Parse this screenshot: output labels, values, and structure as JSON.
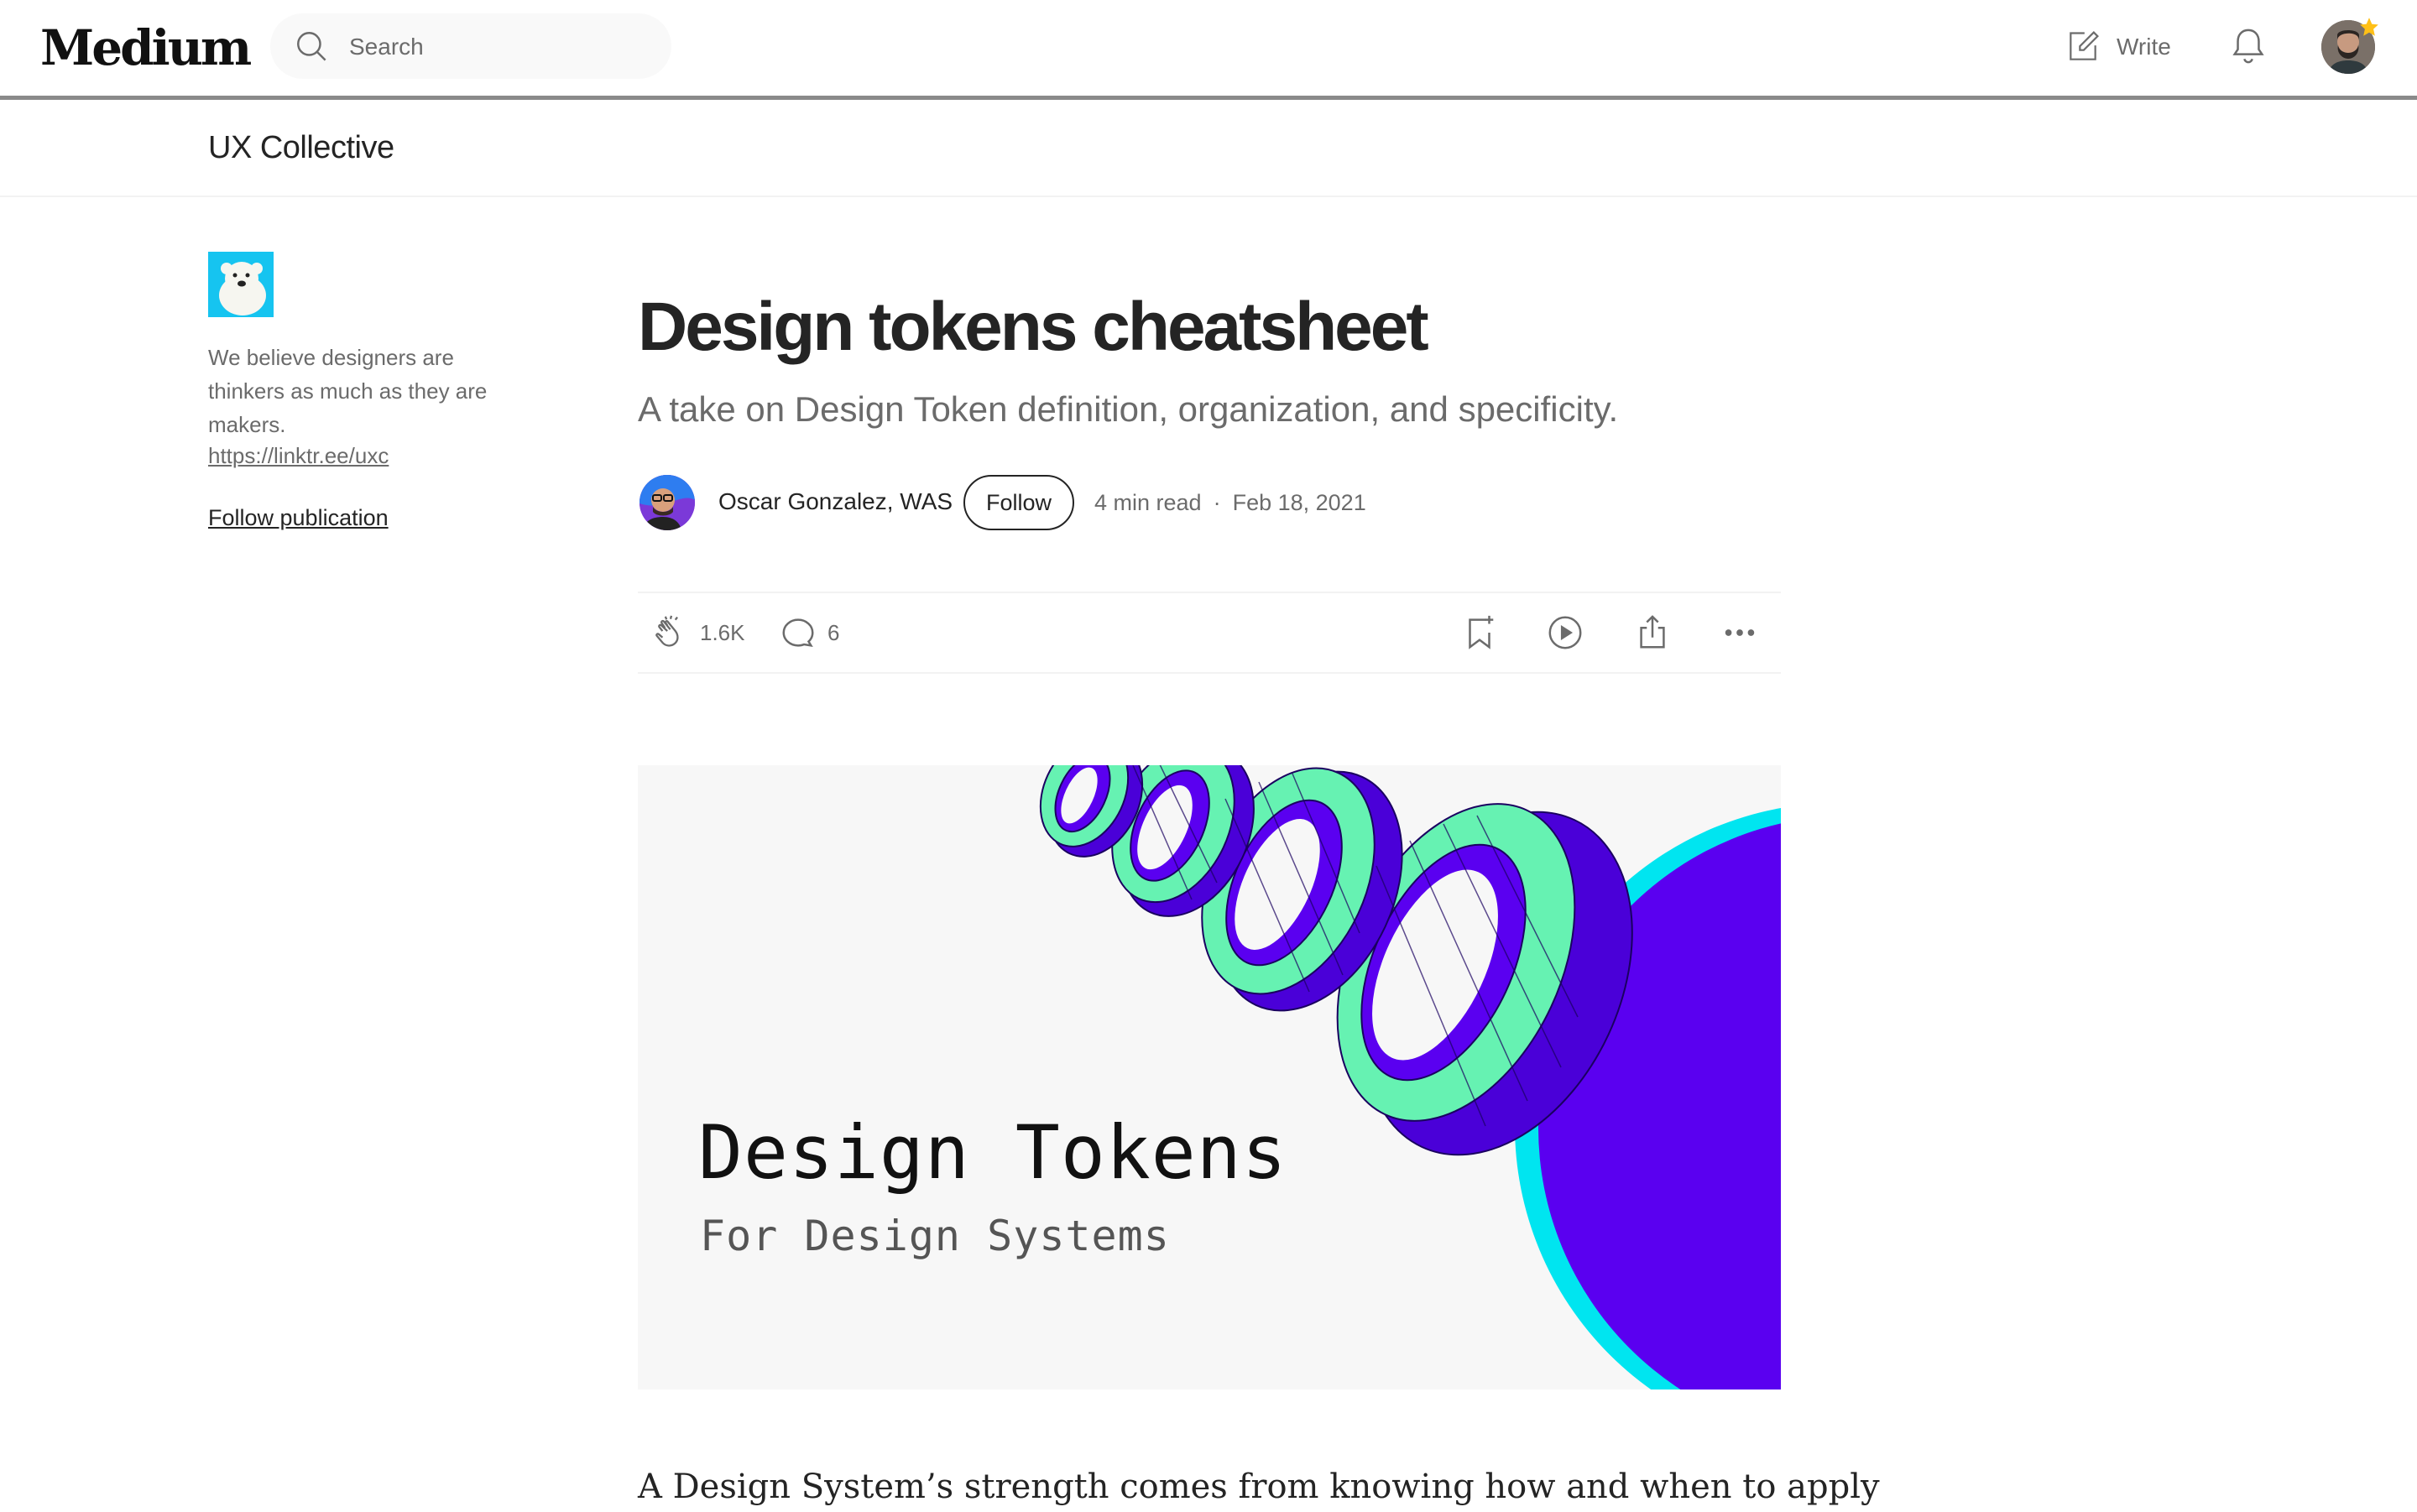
{
  "nav": {
    "logo": "Medium",
    "search_placeholder": "Search",
    "write_label": "Write"
  },
  "publication": {
    "name": "UX Collective",
    "description": "We believe designers are thinkers as much as they are makers.",
    "link": "https://linktr.ee/uxc",
    "follow_label": "Follow publication"
  },
  "article": {
    "title": "Design tokens cheatsheet",
    "subtitle": "A take on Design Token definition, organization, and specificity.",
    "author": "Oscar Gonzalez, WAS",
    "follow_label": "Follow",
    "read_time": "4 min read",
    "date": "Feb 18, 2021",
    "claps": "1.6K",
    "comments": "6",
    "hero": {
      "title": "Design Tokens",
      "subtitle": "For Design Systems"
    },
    "body_first_line": "A Design System’s strength comes from knowing how and when to apply"
  },
  "icons": {
    "search": "search-icon",
    "write": "write-icon",
    "bell": "bell-icon",
    "clap": "clap-icon",
    "comment": "comment-icon",
    "bookmark": "bookmark-add-icon",
    "listen": "play-icon",
    "share": "share-icon",
    "more": "more-icon"
  },
  "colors": {
    "text": "#242424",
    "muted": "#6b6b6b",
    "hero_purple": "#5a00f0",
    "hero_mint": "#66f2b2",
    "hero_cyan": "#00e5f0"
  }
}
